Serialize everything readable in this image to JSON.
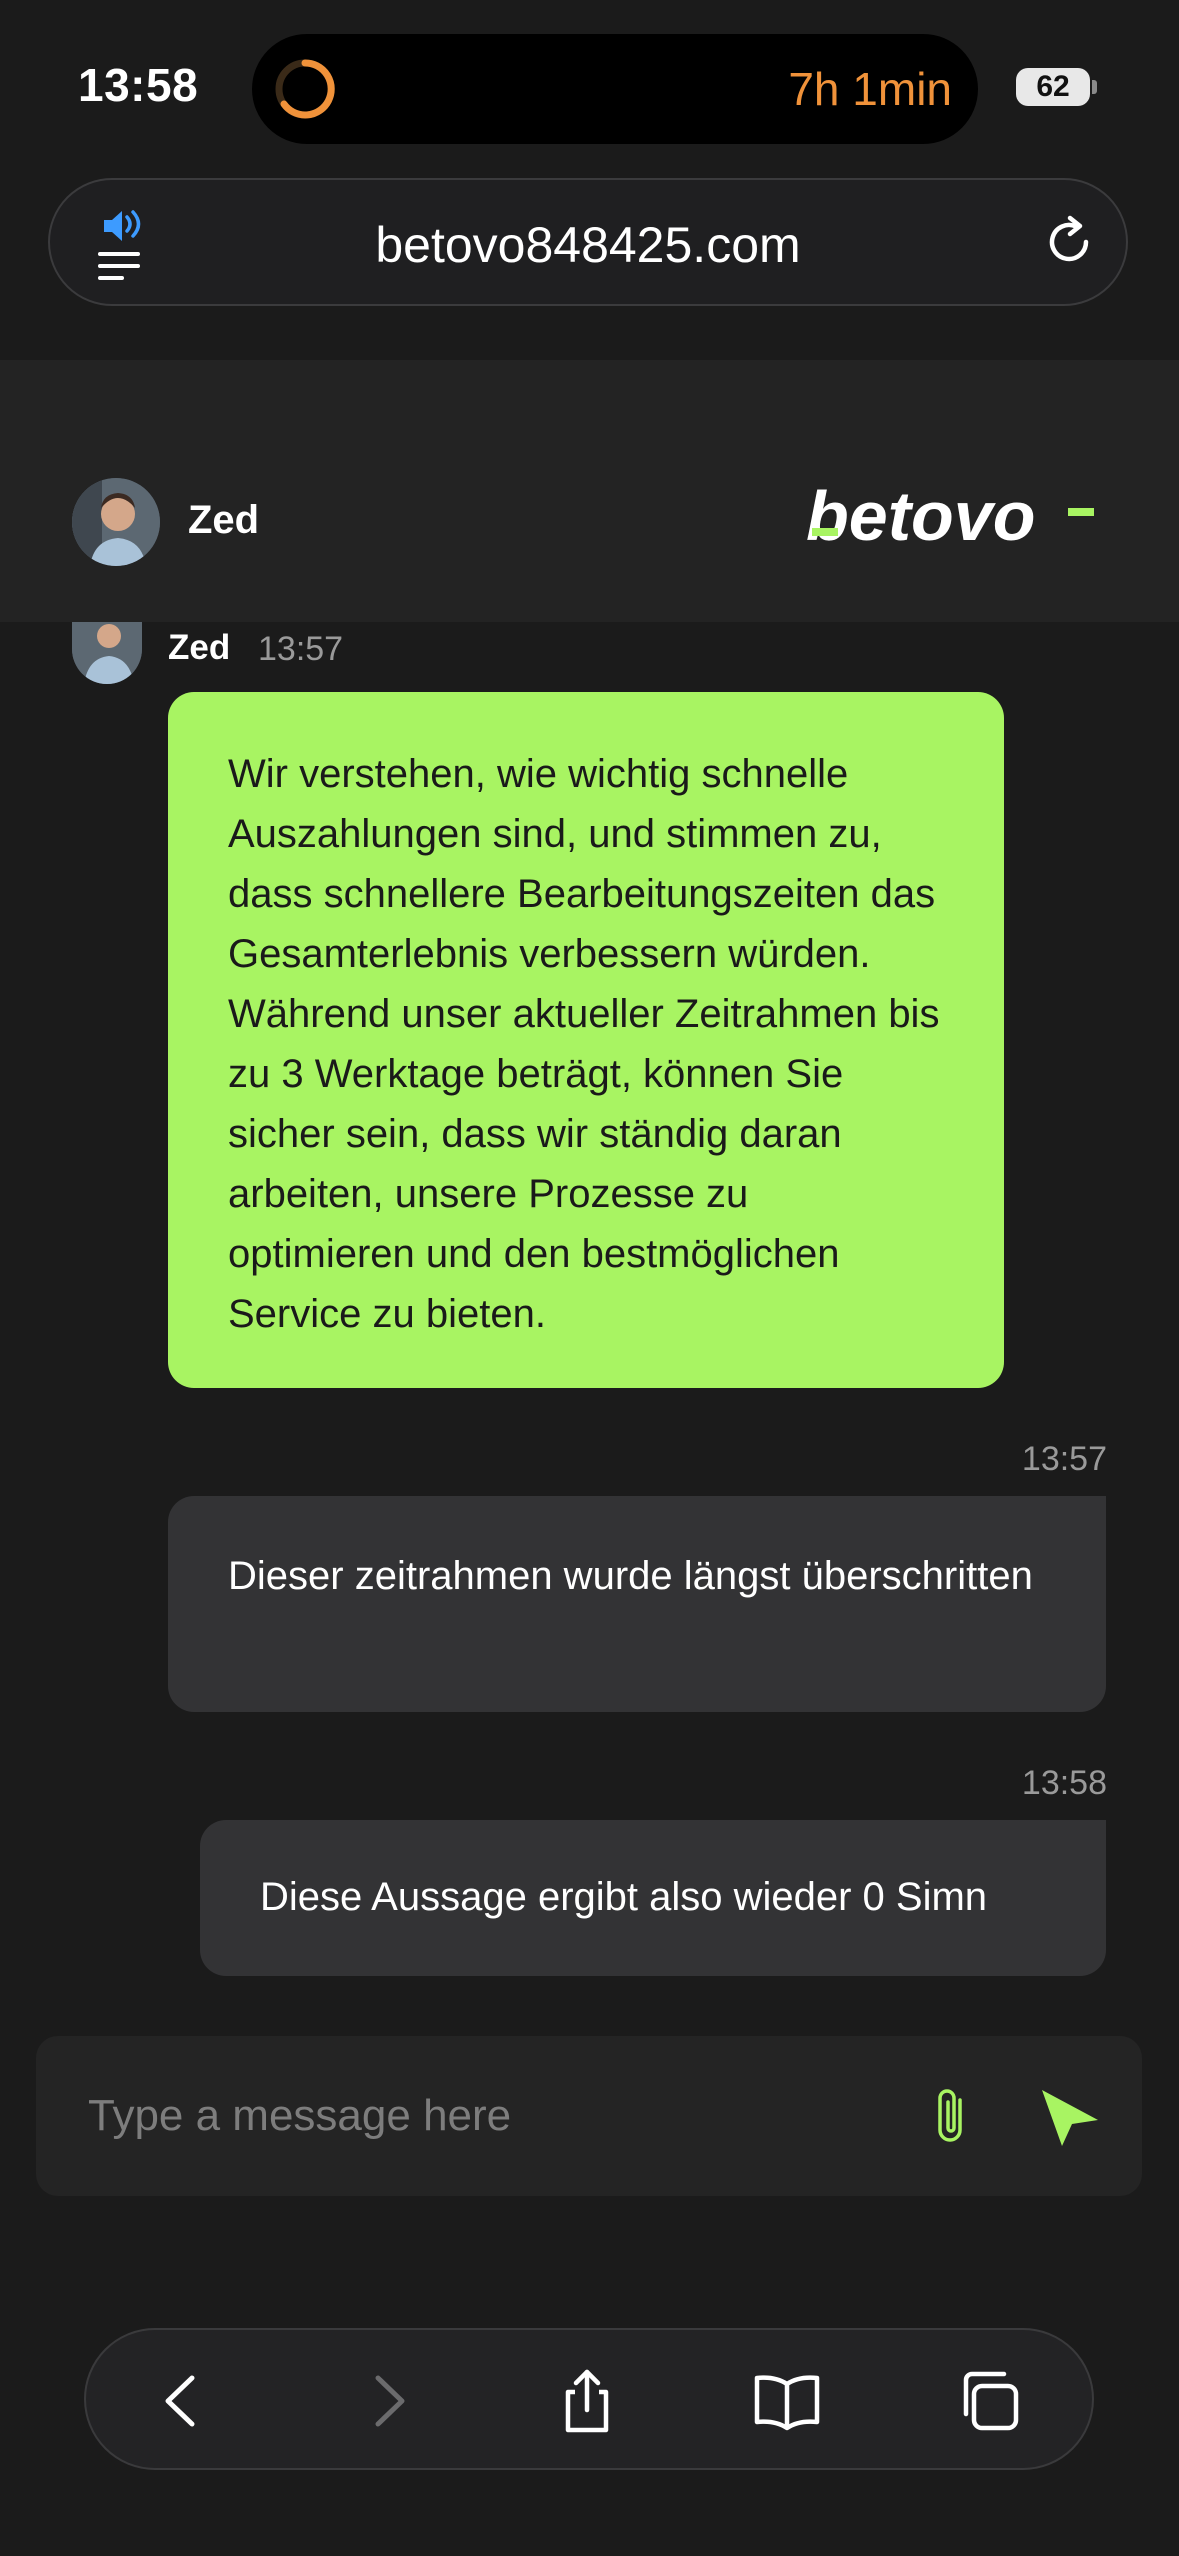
{
  "status_bar": {
    "time": "13:58",
    "activity_timer": "7h 1min",
    "battery": "62"
  },
  "browser": {
    "url": "betovo848425.com"
  },
  "chat_header": {
    "agent_name": "Zed",
    "brand": "betovo",
    "accent_color": "#a8f462"
  },
  "messages": [
    {
      "sender": "Zed",
      "time": "13:57",
      "text": "Wir verstehen, wie wichtig schnelle Auszahlungen sind, und stimmen zu, dass schnellere Bearbeitungszeiten das Gesamterlebnis verbessern würden. Während unser aktueller Zeitrahmen bis zu 3 Werktage beträgt, können Sie sicher sein, dass wir ständig daran arbeiten, unsere Prozesse zu optimieren und den bestmöglichen Service zu bieten."
    },
    {
      "sender": "user",
      "time": "13:57",
      "text": "Dieser zeitrahmen wurde längst überschritten"
    },
    {
      "sender": "user",
      "time": "13:58",
      "text": "Diese Aussage ergibt also wieder 0 Simn"
    }
  ],
  "composer": {
    "placeholder": "Type a message here"
  },
  "icons": {
    "menu": "more-icon",
    "power": "power-icon",
    "collapse": "chevron-down-icon",
    "attach": "paperclip-icon",
    "send": "send-icon",
    "back": "back-icon",
    "forward": "forward-icon",
    "share": "share-icon",
    "bookmarks": "book-icon",
    "tabs": "tabs-icon"
  }
}
